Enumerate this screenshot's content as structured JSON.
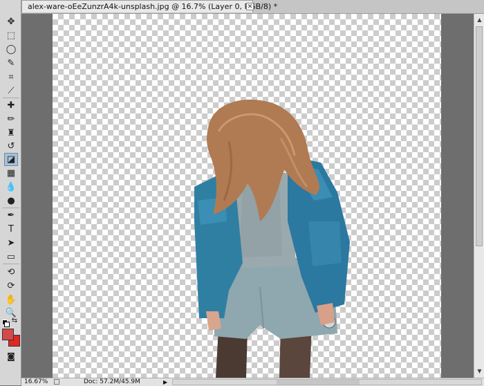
{
  "document": {
    "tab_title": "alex-ware-oEeZunzrA4k-unsplash.jpg @ 16.7% (Layer 0, RGB/8) *",
    "close_glyph": "✕"
  },
  "tools": [
    {
      "name": "move-tool",
      "glyph": "✥"
    },
    {
      "name": "marquee-tool",
      "glyph": "⬚"
    },
    {
      "name": "lasso-tool",
      "glyph": "◯"
    },
    {
      "name": "quick-selection-tool",
      "glyph": "✎"
    },
    {
      "name": "crop-tool",
      "glyph": "⌗"
    },
    {
      "name": "eyedropper-tool",
      "glyph": "⟋"
    },
    {
      "name": "healing-brush-tool",
      "glyph": "✚"
    },
    {
      "name": "brush-tool",
      "glyph": "✏"
    },
    {
      "name": "clone-stamp-tool",
      "glyph": "♜"
    },
    {
      "name": "history-brush-tool",
      "glyph": "↺"
    },
    {
      "name": "eraser-tool",
      "glyph": "◪"
    },
    {
      "name": "gradient-tool",
      "glyph": "▦"
    },
    {
      "name": "blur-tool",
      "glyph": "💧"
    },
    {
      "name": "dodge-tool",
      "glyph": "●"
    },
    {
      "name": "pen-tool",
      "glyph": "✒"
    },
    {
      "name": "type-tool",
      "glyph": "T"
    },
    {
      "name": "path-selection-tool",
      "glyph": "➤"
    },
    {
      "name": "rectangle-tool",
      "glyph": "▭"
    },
    {
      "name": "3d-rotate-tool",
      "glyph": "⟲"
    },
    {
      "name": "3d-orbit-tool",
      "glyph": "⟳"
    },
    {
      "name": "hand-tool",
      "glyph": "✋"
    },
    {
      "name": "zoom-tool",
      "glyph": "🔍"
    }
  ],
  "colors": {
    "foreground": "#d34a4a",
    "background": "#e3261f",
    "active_tool_highlight": "#a7bfd7"
  },
  "statusbar": {
    "zoom": "16.67%",
    "doc_info": "Doc: 57.2M/45.9M",
    "arrow_glyph": "▶"
  },
  "active_tool": "eraser-tool"
}
